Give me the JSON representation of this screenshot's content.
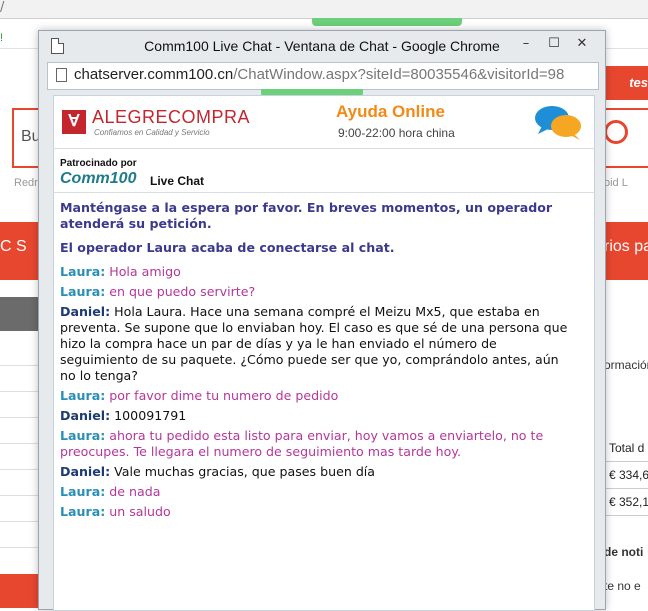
{
  "background": {
    "left_snippet": "Bu",
    "left_small": "Redr",
    "right_small": "oid L",
    "right_badge": "tes",
    "nav_left": "C  S",
    "nav_right": "rios pa",
    "right_texts": [
      "ormación",
      "de noti",
      "te no e"
    ],
    "table": [
      "Total d",
      "€ 334,6",
      "€ 352,1"
    ],
    "exclam": "!",
    "slash": "/"
  },
  "window": {
    "title": "Comm100 Live Chat - Ventana de Chat - Google Chrome",
    "url_host": "chatserver.comm100.cn",
    "url_path": "/ChatWindow.aspx?siteId=80035546&visitorId=98",
    "controls": {
      "minimize": "–",
      "maximize": "☐",
      "close": "✕"
    }
  },
  "header": {
    "logo_name": "ALEGRECOMPRA",
    "logo_tagline": "Confiamos en Calidad y Servicio",
    "help_title": "Ayuda Online",
    "help_hours": "9:00-22:00 hora china"
  },
  "sponsor": {
    "label": "Patrocinado por",
    "brand": "Comm100",
    "live": "Live Chat"
  },
  "chat": {
    "system_wait": "Manténgase a la espera por favor. En breves momentos, un operador atenderá su petición.",
    "system_connected": "El operador Laura acaba de conectarse al chat.",
    "messages": [
      {
        "who": "Laura:",
        "text": "Hola amigo"
      },
      {
        "who": "Laura:",
        "text": "en que puedo servirte?"
      },
      {
        "who": "Daniel:",
        "text": "Hola Laura. Hace una semana compré el Meizu Mx5, que estaba en preventa. Se supone que lo enviaban hoy. El caso es que sé de una persona que hizo la compra hace un par de días y ya le han enviado el número de seguimiento de su paquete. ¿Cómo puede ser que yo, comprándolo antes, aún no lo tenga?"
      },
      {
        "who": "Laura:",
        "text": "por favor dime tu numero de pedido"
      },
      {
        "who": "Daniel:",
        "text": "100091791"
      },
      {
        "who": "Laura:",
        "text": "ahora tu pedido esta listo para enviar, hoy vamos a enviartelo, no te preocupes. Te llegara el numero de seguimiento mas tarde hoy."
      },
      {
        "who": "Daniel:",
        "text": "Vale muchas gracias, que pases buen día"
      },
      {
        "who": "Laura:",
        "text": "de nada"
      },
      {
        "who": "Laura:",
        "text": "un saludo"
      }
    ]
  }
}
